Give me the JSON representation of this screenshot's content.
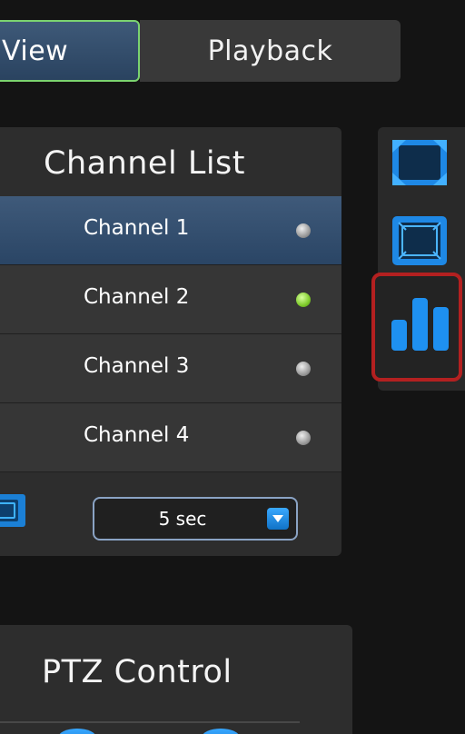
{
  "tabs": {
    "live_view": "View",
    "playback": "Playback"
  },
  "channel_list": {
    "title": "Channel List",
    "channels": [
      {
        "label": "Channel 1",
        "status": "inactive",
        "selected": true
      },
      {
        "label": "Channel 2",
        "status": "active",
        "selected": false
      },
      {
        "label": "Channel 3",
        "status": "inactive",
        "selected": false
      },
      {
        "label": "Channel 4",
        "status": "inactive",
        "selected": false
      }
    ],
    "dwell_time": {
      "value": "5 sec"
    }
  },
  "ptz": {
    "title": "PTZ Control"
  },
  "side_toolbar": {
    "icons": [
      "fullscreen-icon",
      "screen-layout-icon",
      "bar-chart-icon"
    ],
    "highlighted": "bar-chart-icon"
  },
  "colors": {
    "accent_blue": "#1e88e5",
    "status_active": "#7fcb2c",
    "status_inactive": "#9a9a9a",
    "highlight_border": "#b32020",
    "selected_row": "#3a5474"
  }
}
